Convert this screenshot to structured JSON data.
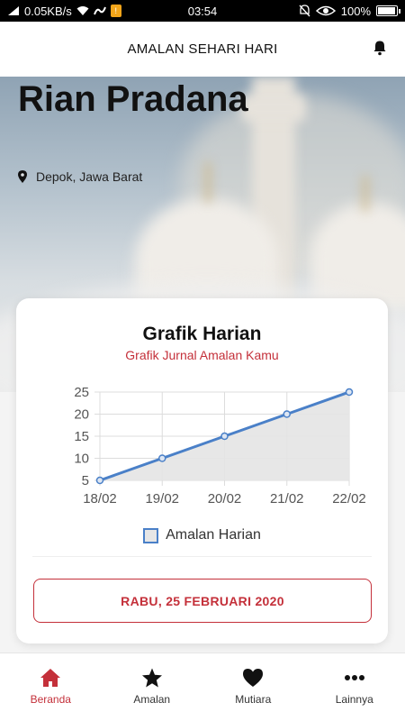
{
  "status_bar": {
    "speed": "0.05KB/s",
    "time": "03:54",
    "battery": "100%",
    "battery_level": 1.0
  },
  "header": {
    "title": "AMALAN SEHARI HARI",
    "bell_icon": "bell-icon"
  },
  "profile": {
    "name": "Rian Pradana",
    "location": "Depok, Jawa Barat",
    "location_icon": "map-pin-icon"
  },
  "card": {
    "title": "Grafik Harian",
    "subtitle": "Grafik Jurnal Amalan Kamu",
    "date_button": "RABU, 25 FEBRUARI 2020"
  },
  "chart_data": {
    "type": "area",
    "x": [
      "18/02",
      "19/02",
      "20/02",
      "21/02",
      "22/02"
    ],
    "series": [
      {
        "name": "Amalan Harian",
        "values": [
          5,
          10,
          15,
          20,
          25
        ]
      }
    ],
    "yticks": [
      5,
      10,
      15,
      20,
      25
    ],
    "ylim": [
      5,
      25
    ],
    "grid": true,
    "legend": "bottom",
    "line_color": "#4a80c8",
    "fill_color": "#e4e4e4"
  },
  "colors": {
    "accent": "#c4303a",
    "chart_line": "#4a80c8"
  },
  "nav": {
    "items": [
      {
        "label": "Beranda",
        "icon": "home-icon",
        "active": true
      },
      {
        "label": "Amalan",
        "icon": "star-icon",
        "active": false
      },
      {
        "label": "Mutiara",
        "icon": "heart-icon",
        "active": false
      },
      {
        "label": "Lainnya",
        "icon": "more-icon",
        "active": false
      }
    ]
  }
}
